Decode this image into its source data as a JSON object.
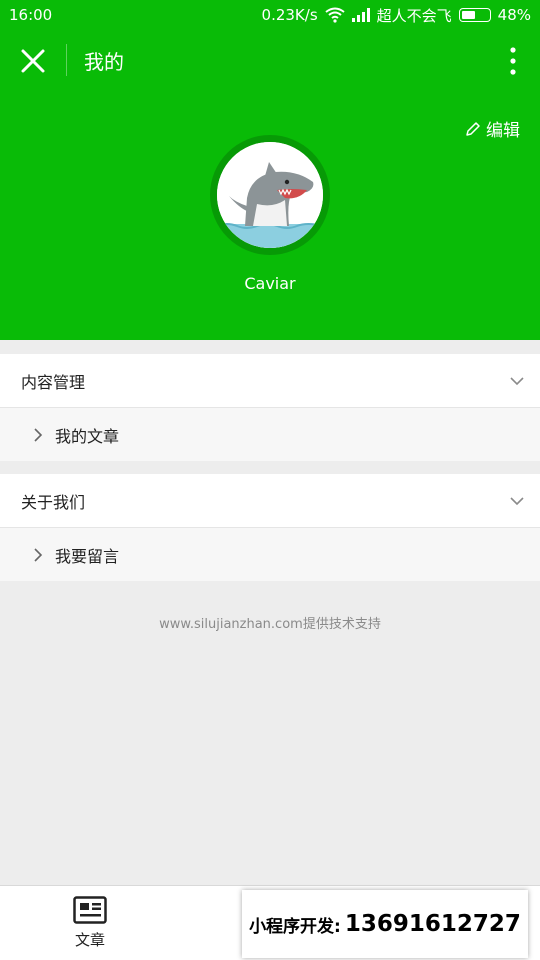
{
  "status_bar": {
    "time": "16:00",
    "network_speed": "0.23K/s",
    "carrier": "超人不会飞",
    "battery": "48%"
  },
  "nav": {
    "title": "我的"
  },
  "profile": {
    "edit_label": "编辑",
    "nickname": "Caviar"
  },
  "sections": [
    {
      "title": "内容管理",
      "item": "我的文章"
    },
    {
      "title": "关于我们",
      "item": "我要留言"
    }
  ],
  "footer": {
    "support_text": "www.silujianzhan.com提供技术支持"
  },
  "tabbar": {
    "tab_label": "文章"
  },
  "promo": {
    "label": "小程序开发:",
    "phone": "13691612727"
  },
  "colors": {
    "brand_green": "#09bb07"
  }
}
